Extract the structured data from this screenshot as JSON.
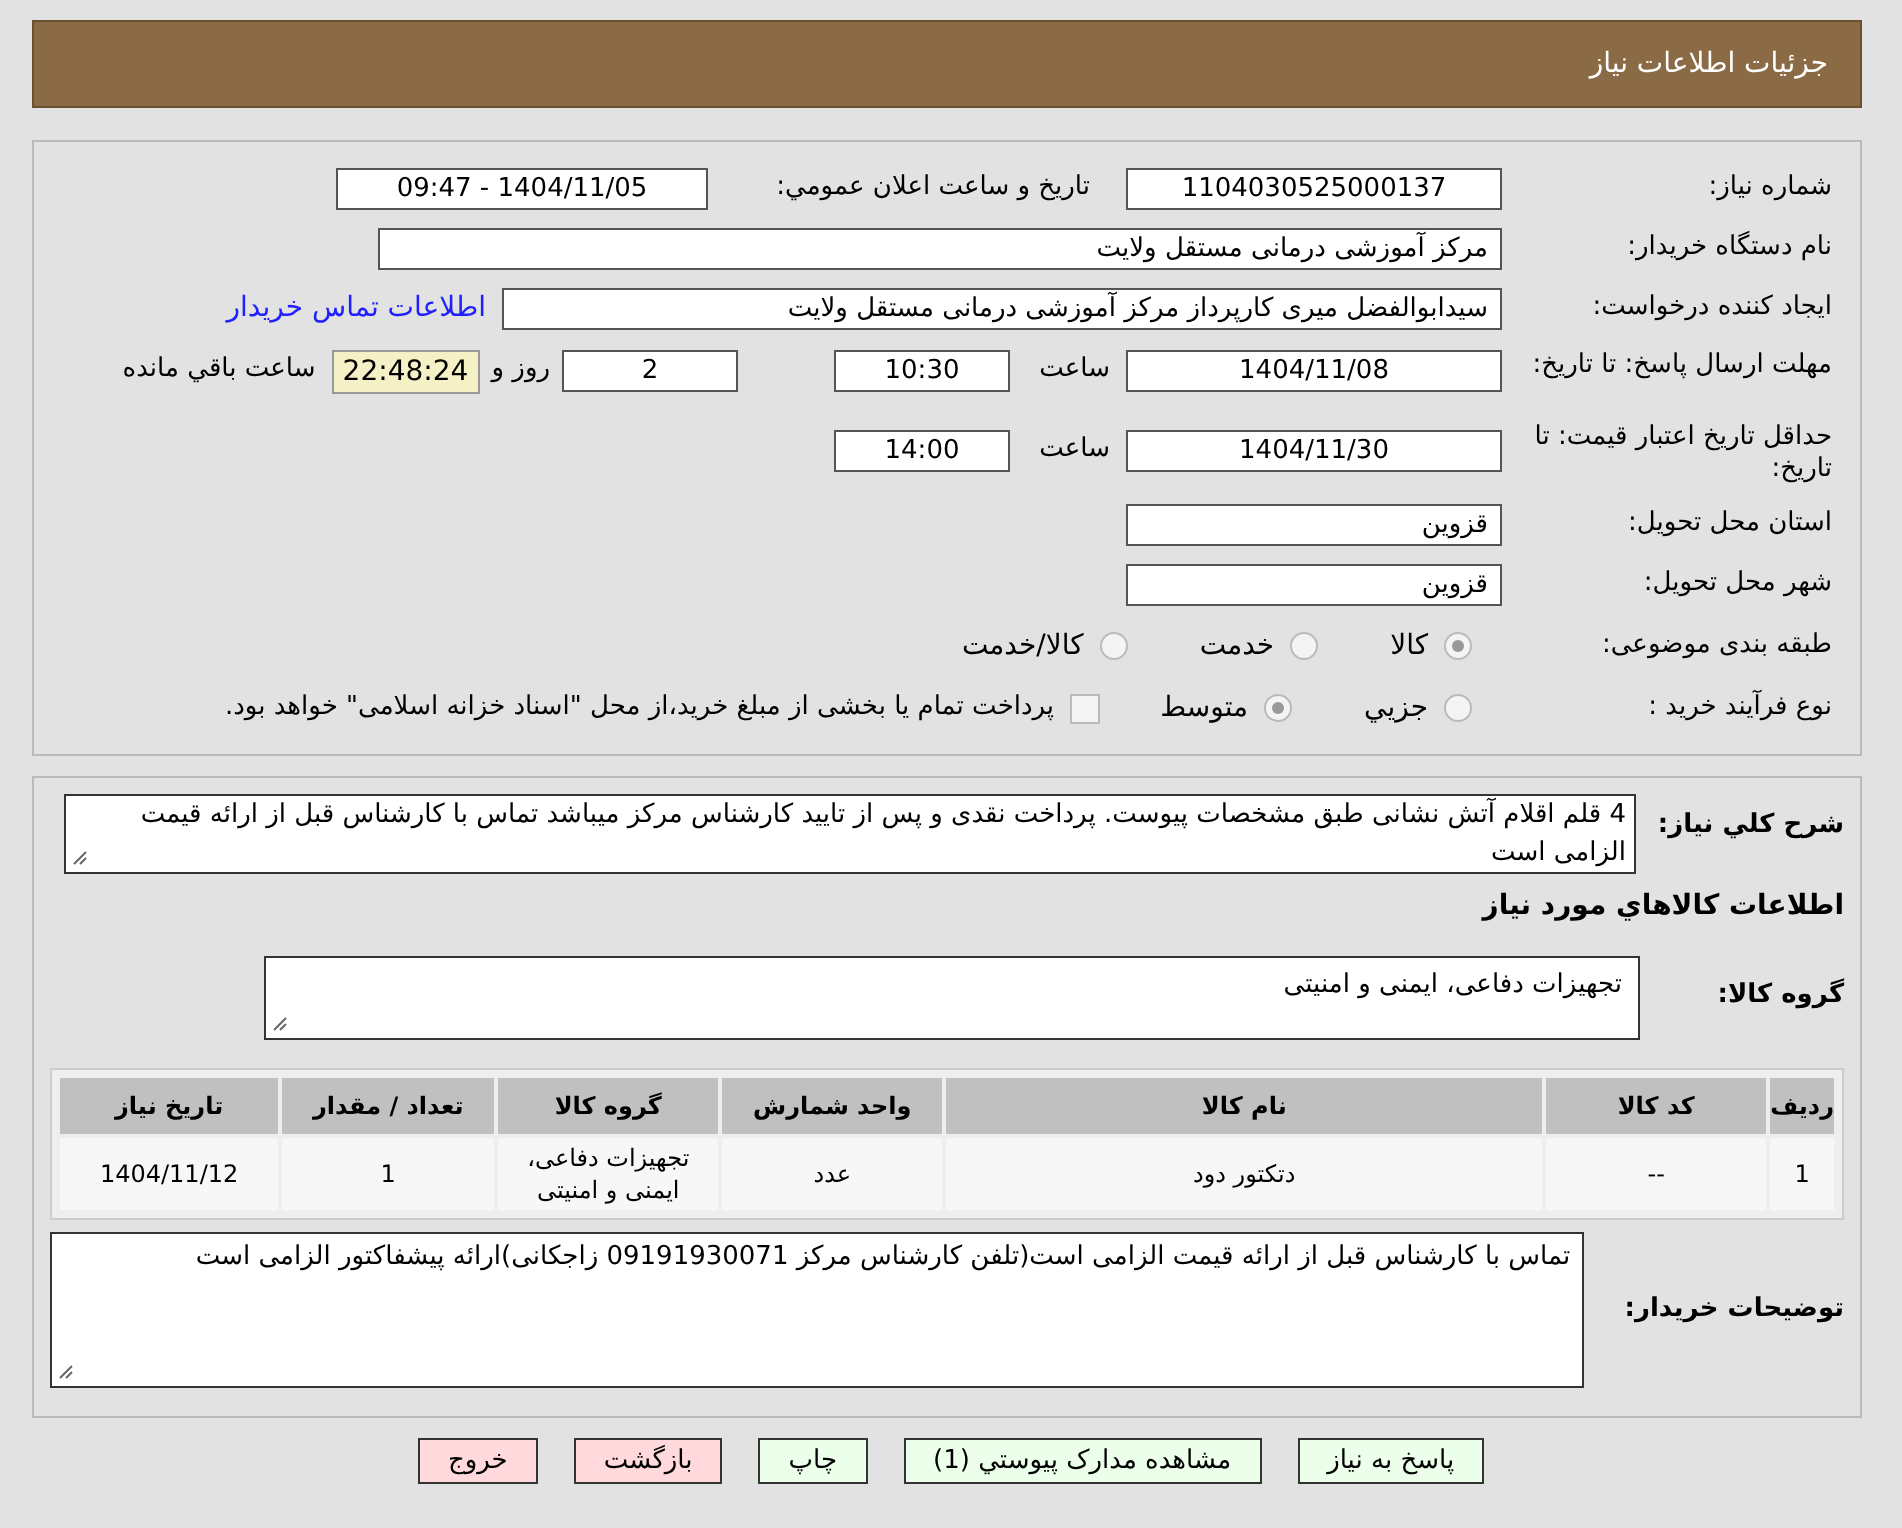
{
  "header": {
    "title": "جزئیات اطلاعات نیاز"
  },
  "need_number": {
    "label": "شماره نیاز:",
    "value": "1104030525000137"
  },
  "announce": {
    "label": "تاریخ و ساعت اعلان عمومي:",
    "value": "1404/11/05 - 09:47"
  },
  "buyer": {
    "label": "نام دستگاه خریدار:",
    "value": "مرکز آموزشی درمانی مستقل ولایت"
  },
  "requester": {
    "label": "ایجاد کننده درخواست:",
    "value": "سیدابوالفضل میری کارپرداز مرکز آموزشی درمانی مستقل ولایت",
    "link": "اطلاعات تماس خریدار"
  },
  "deadline": {
    "label": "مهلت ارسال پاسخ: تا تاریخ:",
    "date": "1404/11/08",
    "time_label": "ساعت",
    "time": "10:30",
    "days": "2",
    "days_label": "روز و",
    "remaining": "22:48:24",
    "remaining_label": "ساعت باقي مانده"
  },
  "validity": {
    "label": "حداقل تاریخ اعتبار قیمت: تا تاریخ:",
    "date": "1404/11/30",
    "time_label": "ساعت",
    "time": "14:00"
  },
  "province": {
    "label": "استان محل تحویل:",
    "value": "قزوین"
  },
  "city": {
    "label": "شهر محل تحویل:",
    "value": "قزوین"
  },
  "category": {
    "label": "طبقه بندی موضوعی:",
    "options": [
      {
        "label": "کالا",
        "selected": true
      },
      {
        "label": "خدمت",
        "selected": false
      },
      {
        "label": "کالا/خدمت",
        "selected": false
      }
    ]
  },
  "process": {
    "label": "نوع فرآیند خرید :",
    "options": [
      {
        "label": "جزيي",
        "selected": false
      },
      {
        "label": "متوسط",
        "selected": true
      }
    ],
    "payment": {
      "checked": false,
      "label": "پرداخت تمام یا بخشی از مبلغ خرید،از محل \"اسناد خزانه اسلامی\" خواهد بود."
    }
  },
  "description": {
    "label": "شرح کلي نیاز:",
    "value": "4 قلم اقلام آتش نشانی طبق مشخصات پیوست. پرداخت نقدی و پس از تایید کارشناس مرکز میباشد  تماس با کارشناس قبل از ارائه قیمت الزامی است"
  },
  "goods_title": "اطلاعات کالاهاي مورد نیاز",
  "goods_group": {
    "label": "گروه کالا:",
    "value": "تجهیزات دفاعی، ایمنی و امنیتی"
  },
  "table": {
    "columns": [
      "ردیف",
      "کد کالا",
      "نام کالا",
      "واحد شمارش",
      "گروه کالا",
      "تعداد / مقدار",
      "تاریخ نیاز"
    ],
    "rows": [
      [
        "1",
        "--",
        "دتکتور دود",
        "عدد",
        "تجهیزات دفاعی، ایمنی و امنیتی",
        "1",
        "1404/11/12"
      ]
    ]
  },
  "buyer_notes": {
    "label": "توضیحات خریدار:",
    "value": "تماس با کارشناس قبل از ارائه قیمت الزامی است(تلفن کارشناس مرکز  09191930071 زاجکانی)ارائه پیشفاکتور الزامی است"
  },
  "buttons": [
    {
      "label": "پاسخ به نیاز",
      "kind": "action"
    },
    {
      "label": "مشاهده مدارک پیوستي (1)",
      "kind": "action"
    },
    {
      "label": "چاپ",
      "kind": "action"
    },
    {
      "label": "بازگشت",
      "kind": "nav"
    },
    {
      "label": "خروج",
      "kind": "nav"
    }
  ]
}
